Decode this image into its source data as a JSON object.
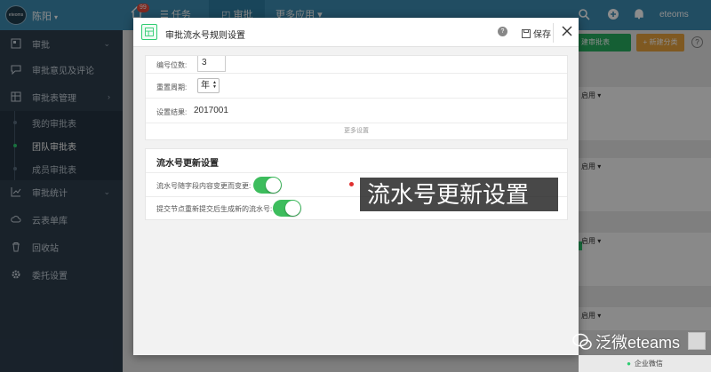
{
  "topbar": {
    "logo_text": "eteoms",
    "user": "陈阳",
    "badge": "99",
    "nav": [
      "任务",
      "审批",
      "更多应用"
    ],
    "account": "eteoms"
  },
  "sidebar": {
    "items": [
      {
        "label": "审批",
        "icon": "form-icon"
      },
      {
        "label": "审批意见及评论",
        "icon": "comment-icon"
      },
      {
        "label": "审批表管理",
        "icon": "table-icon"
      },
      {
        "label": "审批统计",
        "icon": "chart-icon"
      },
      {
        "label": "云表单库",
        "icon": "cloud-icon"
      },
      {
        "label": "回收站",
        "icon": "trash-icon"
      },
      {
        "label": "委托设置",
        "icon": "gear-icon"
      }
    ],
    "subitems": [
      "我的审批表",
      "团队审批表",
      "成员审批表"
    ]
  },
  "background": {
    "toolbar_btn": "建审批表",
    "new_btn": "+ 新建分类",
    "help": "?",
    "enable_label": "启用"
  },
  "modal": {
    "title": "审批流水号规则设置",
    "help": "?",
    "save_label": "保存",
    "digits_label": "编号位数:",
    "digits_value": "3",
    "period_label": "重置周期:",
    "period_value": "年",
    "result_label": "设置结果:",
    "result_value": "2017001",
    "more_label": "更多设置",
    "update_section_title": "流水号更新设置",
    "toggle1_label": "流水号随字段内容变更而变更:",
    "toggle2_label": "提交节点重新提交后生成新的流水号:",
    "toggle1_on": true,
    "toggle2_on": true
  },
  "callout": "流水号更新设置",
  "watermark": "泛微eteams",
  "bottom_chip": "企业微信",
  "colors": {
    "topbar": "#3d8cb2",
    "sidebar": "#2e3e4e",
    "toggle": "#3dbd5d",
    "accent_green": "#27ae60",
    "accent_orange": "#e8a33d"
  }
}
